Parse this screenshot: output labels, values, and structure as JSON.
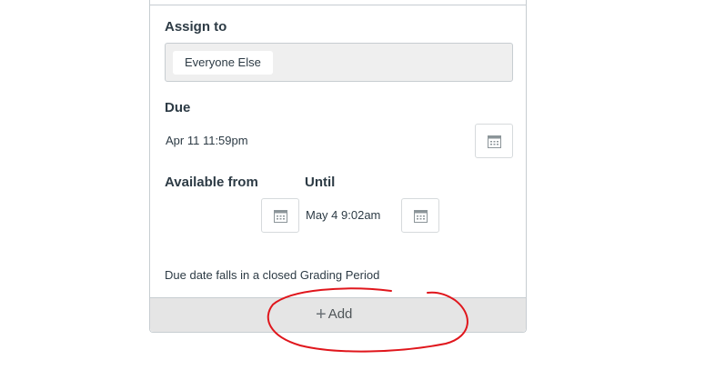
{
  "assign": {
    "label": "Assign to",
    "chip": "Everyone Else"
  },
  "due": {
    "label": "Due",
    "value": "Apr 11 11:59pm"
  },
  "available_from": {
    "label": "Available from",
    "value": ""
  },
  "until": {
    "label": "Until",
    "value": "May 4 9:02am"
  },
  "note": "Due date falls in a closed Grading Period",
  "add_button": {
    "plus_glyph": "+",
    "label": "Add"
  },
  "icons": {
    "calendar": "calendar-icon",
    "plus": "plus-icon"
  },
  "colors": {
    "annotation": "#e0161c",
    "text": "#2d3b45",
    "add_bar": "#e5e5e5"
  }
}
